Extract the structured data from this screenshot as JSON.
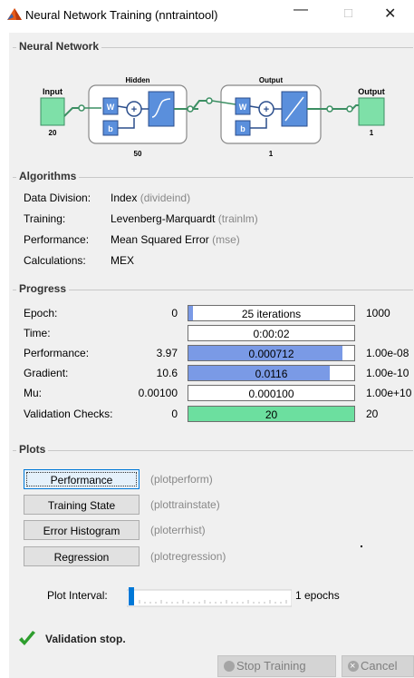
{
  "window": {
    "title": "Neural Network Training (nntraintool)",
    "minimize": "—",
    "maximize": "□",
    "close": "✕"
  },
  "network": {
    "section_title": "Neural Network",
    "input_label": "Input",
    "input_size": "20",
    "hidden_label": "Hidden",
    "hidden_size": "50",
    "output_layer_label": "Output",
    "output_layer_size": "1",
    "output_label": "Output",
    "output_size": "1",
    "weight_symbol": "W",
    "bias_symbol": "b",
    "sum_symbol": "+"
  },
  "algorithms": {
    "section_title": "Algorithms",
    "rows": [
      {
        "label": "Data Division:",
        "value": "Index",
        "fn": "(divideind)"
      },
      {
        "label": "Training:",
        "value": "Levenberg-Marquardt",
        "fn": "(trainlm)"
      },
      {
        "label": "Performance:",
        "value": "Mean Squared Error",
        "fn": "(mse)"
      },
      {
        "label": "Calculations:",
        "value": "MEX",
        "fn": ""
      }
    ]
  },
  "progress": {
    "section_title": "Progress",
    "rows": [
      {
        "label": "Epoch:",
        "min": "0",
        "current": "25 iterations",
        "max": "1000",
        "fill": 0.025,
        "style": "blue"
      },
      {
        "label": "Time:",
        "min": "",
        "current": "0:00:02",
        "max": "",
        "fill": 0,
        "style": "blue"
      },
      {
        "label": "Performance:",
        "min": "3.97",
        "current": "0.000712",
        "max": "1.00e-08",
        "fill": 0.93,
        "style": "blue"
      },
      {
        "label": "Gradient:",
        "min": "10.6",
        "current": "0.0116",
        "max": "1.00e-10",
        "fill": 0.85,
        "style": "blue"
      },
      {
        "label": "Mu:",
        "min": "0.00100",
        "current": "0.000100",
        "max": "1.00e+10",
        "fill": 0,
        "style": "blue"
      },
      {
        "label": "Validation Checks:",
        "min": "0",
        "current": "20",
        "max": "20",
        "fill": 1.0,
        "style": "green"
      }
    ]
  },
  "plots": {
    "section_title": "Plots",
    "buttons": [
      {
        "label": "Performance",
        "fn": "(plotperform)"
      },
      {
        "label": "Training State",
        "fn": "(plottrainstate)"
      },
      {
        "label": "Error Histogram",
        "fn": "(ploterrhist)"
      },
      {
        "label": "Regression",
        "fn": "(plotregression)"
      }
    ],
    "interval_label": "Plot Interval:",
    "interval_value": "1 epochs"
  },
  "status": {
    "text": "Validation stop."
  },
  "buttons": {
    "stop_training": "Stop Training",
    "cancel": "Cancel"
  },
  "colors": {
    "bar_blue": "#7a9ae6",
    "bar_green": "#6cdf9f",
    "nn_block": "#5a8fdc",
    "io_green": "#7ee0a8",
    "check_green": "#2e9e2e"
  }
}
